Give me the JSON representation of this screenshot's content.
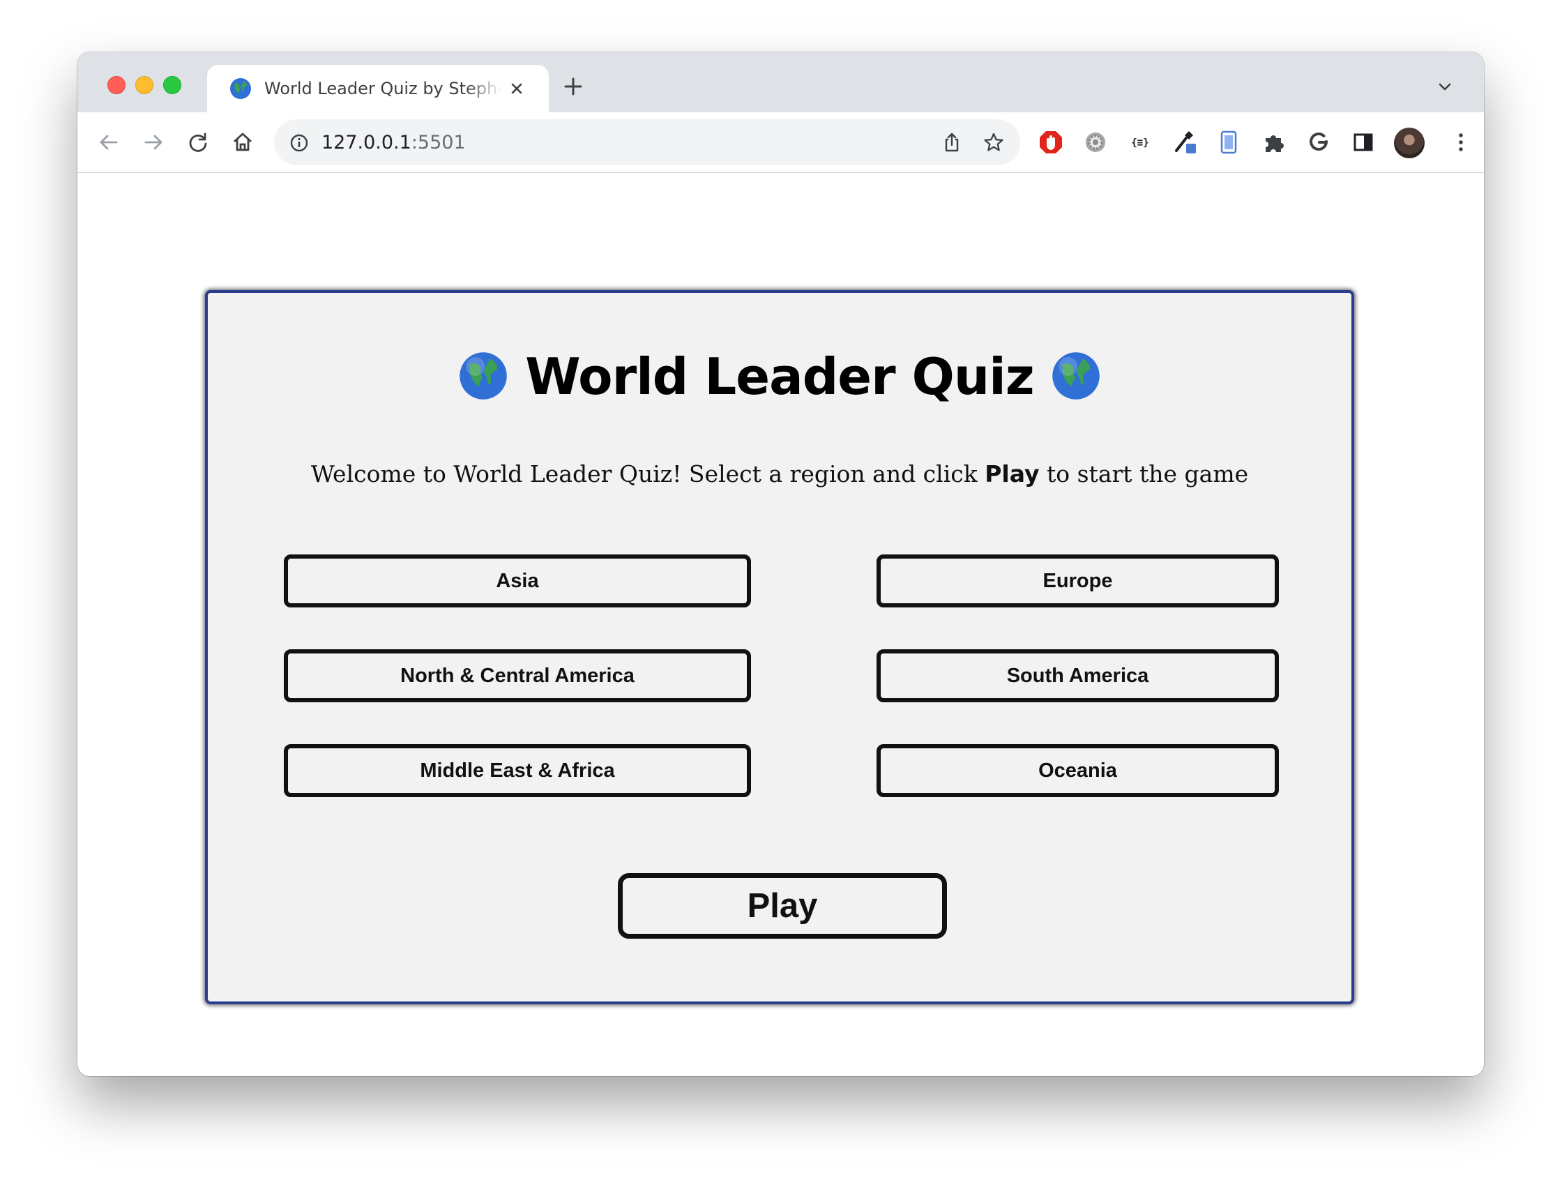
{
  "browser": {
    "tab_title": "World Leader Quiz by Stephen",
    "url_host": "127.0.0.1",
    "url_port": ":5501"
  },
  "quiz": {
    "title": "World Leader Quiz",
    "welcome_before": "Welcome to World Leader Quiz! Select a region and click ",
    "welcome_bold": "Play",
    "welcome_after": " to start the game",
    "regions": [
      "Asia",
      "Europe",
      "North & Central America",
      "South America",
      "Middle East & Africa",
      "Oceania"
    ],
    "play_label": "Play"
  },
  "icons": {
    "title_emoji": "globe-americas-icon",
    "tab_favicon": "globe-americas-icon"
  }
}
